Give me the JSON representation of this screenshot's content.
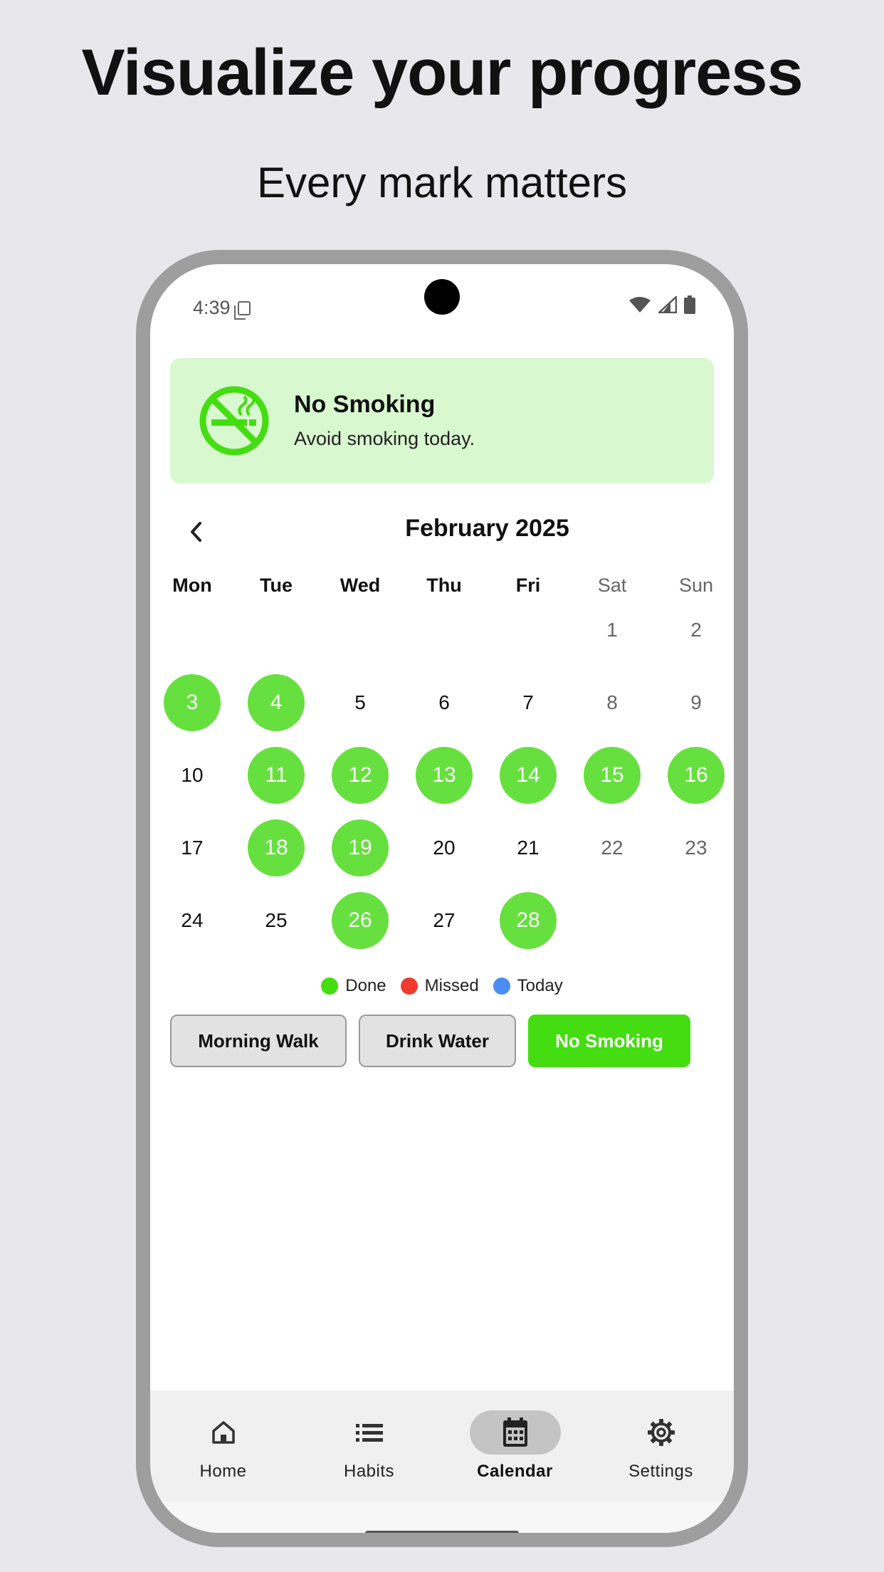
{
  "headline": "Visualize your progress",
  "subheadline": "Every mark matters",
  "status_bar": {
    "time": "4:39"
  },
  "habit_banner": {
    "title": "No Smoking",
    "subtitle": "Avoid smoking today.",
    "icon": "no-smoking-icon",
    "background": "#d8f8d0",
    "icon_color": "#44dd11"
  },
  "calendar": {
    "month_label": "February 2025",
    "prev_icon": "chevron-left-icon",
    "weekdays": [
      "Mon",
      "Tue",
      "Wed",
      "Thu",
      "Fri",
      "Sat",
      "Sun"
    ],
    "first_weekday_index": 5,
    "days_in_month": 28,
    "done_days": [
      3,
      4,
      11,
      12,
      13,
      14,
      15,
      16,
      18,
      19,
      26,
      28
    ],
    "done_color": "#66e03e"
  },
  "legend": [
    {
      "label": "Done",
      "color": "#44dd11"
    },
    {
      "label": "Missed",
      "color": "#ee3b2e"
    },
    {
      "label": "Today",
      "color": "#4a8ef5"
    }
  ],
  "habit_chips": [
    {
      "label": "Morning Walk",
      "active": false
    },
    {
      "label": "Drink Water",
      "active": false
    },
    {
      "label": "No Smoking",
      "active": true
    }
  ],
  "bottom_nav": [
    {
      "label": "Home",
      "icon": "home-icon",
      "active": false
    },
    {
      "label": "Habits",
      "icon": "list-icon",
      "active": false
    },
    {
      "label": "Calendar",
      "icon": "calendar-icon",
      "active": true
    },
    {
      "label": "Settings",
      "icon": "gear-icon",
      "active": false
    }
  ]
}
